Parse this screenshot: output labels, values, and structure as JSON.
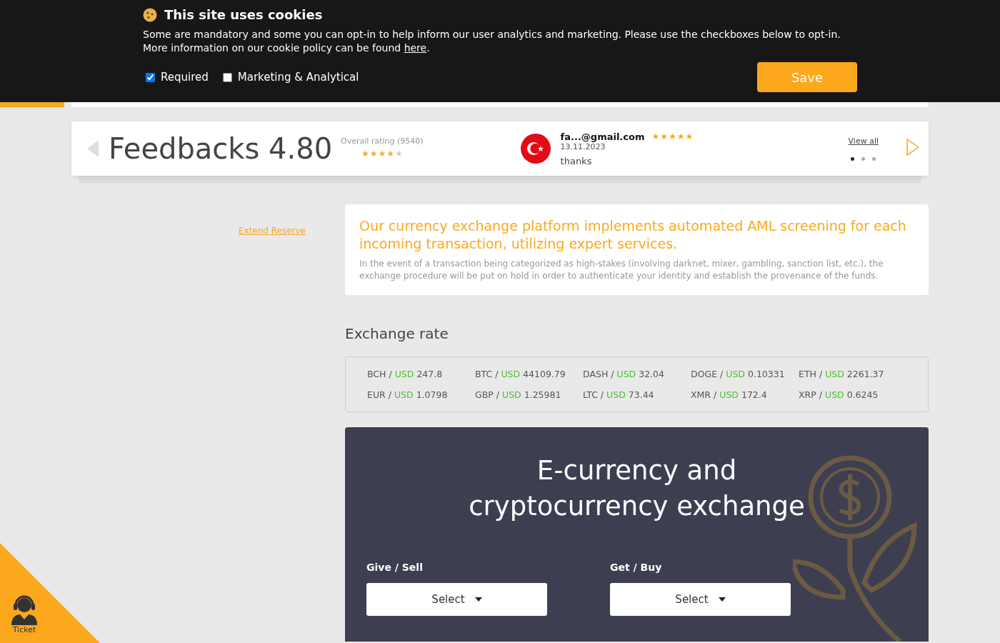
{
  "cookie_banner": {
    "title": "This site uses cookies",
    "text": "Some are mandatory and some you can opt-in to help inform our user analytics and marketing. Please use the checkboxes below to opt-in.",
    "more_text": "More information on our cookie policy can be found",
    "link": "here",
    "end": ".",
    "checkboxes": [
      {
        "label": "Required",
        "checked": true
      },
      {
        "label": "Marketing & Analytical",
        "checked": false
      }
    ],
    "save_button": "Save"
  },
  "feedbacks": {
    "title": "Feedbacks 4.80",
    "overall": "Overall rating (9540)",
    "stars": 4,
    "review": {
      "author": "fa...@gmail.com",
      "stars": 5,
      "date": "13.11.2023",
      "text": "thanks"
    },
    "view_all": "View all",
    "dots": [
      {
        "selected": true
      },
      {
        "selected": false
      },
      {
        "selected": false
      }
    ]
  },
  "extend_reserve": "Extend Reserve",
  "aml_notice": {
    "heading": "Our currency exchange platform implements automated AML screening for each incoming transaction, utilizing expert services.",
    "text": "In the event of a transaction being categorized as high-stakes (involving darknet, mixer, gambling, sanction list, etc.), the exchange procedure will be put on hold in order to authenticate your identity and establish the provenance of the funds."
  },
  "exchange_rate": {
    "title": "Exchange rate",
    "rates": [
      {
        "base": "BCH",
        "separator": "/",
        "quote": "USD",
        "value": "247.8"
      },
      {
        "base": "BTC",
        "separator": "/",
        "quote": "USD",
        "value": "44109.79"
      },
      {
        "base": "DASH",
        "separator": "/",
        "quote": "USD",
        "value": "32.04"
      },
      {
        "base": "DOGE",
        "separator": "/",
        "quote": "USD",
        "value": "0.10331"
      },
      {
        "base": "ETH",
        "separator": "/",
        "quote": "USD",
        "value": "2261.37"
      },
      {
        "base": "EUR",
        "separator": "/",
        "quote": "USD",
        "value": "1.0798"
      },
      {
        "base": "GBP",
        "separator": "/",
        "quote": "USD",
        "value": "1.25981"
      },
      {
        "base": "LTC",
        "separator": "/",
        "quote": "USD",
        "value": "73.44"
      },
      {
        "base": "XMR",
        "separator": "/",
        "quote": "USD",
        "value": "172.4"
      },
      {
        "base": "XRP",
        "separator": "/",
        "quote": "USD",
        "value": "0.6245"
      }
    ]
  },
  "exchange_panel": {
    "title": "E-currency and cryptocurrency exchange",
    "fields": [
      {
        "label": "Give / Sell",
        "value": "Select"
      },
      {
        "label": "Get / Buy",
        "value": "Select"
      }
    ]
  },
  "ticket": {
    "label": "Ticket"
  }
}
